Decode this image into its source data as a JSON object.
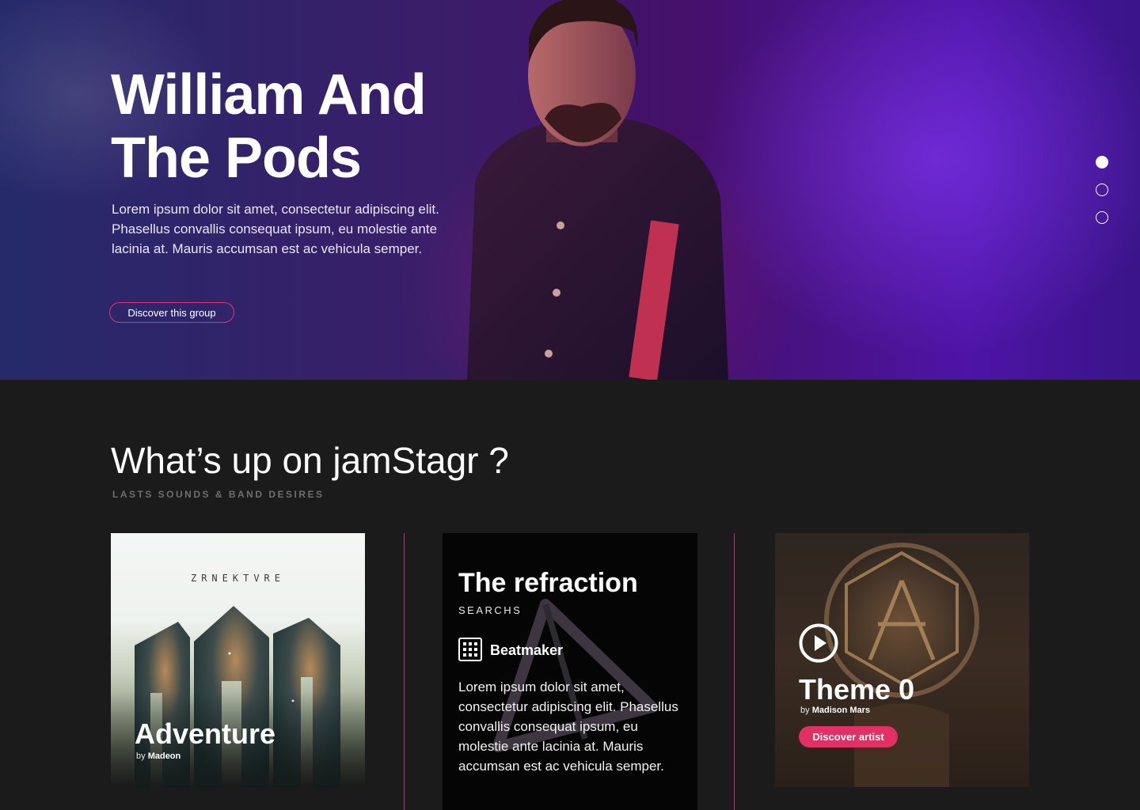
{
  "hero": {
    "title_line1": "William And",
    "title_line2": "The Pods",
    "description": "Lorem ipsum dolor sit amet, consectetur adipiscing elit. Phasellus convallis consequat ipsum, eu molestie ante lacinia at. Mauris accumsan est ac vehicula semper.",
    "button_label": "Discover this group",
    "slides": {
      "total": 3,
      "active": 1
    },
    "accent_color": "#e0327a"
  },
  "section": {
    "title": "What’s up on jamStagr ?",
    "subtitle": "LASTS SOUNDS & BAND DESIRES"
  },
  "cards": [
    {
      "album_logo": "ZRNEKTVRE",
      "title": "Adventure",
      "by": "by",
      "artist": "Madeon"
    },
    {
      "title": "The refraction",
      "subtitle": "SEARCHS",
      "badge_icon": "grid-icon",
      "badge": "Beatmaker",
      "description": "Lorem ipsum dolor sit amet, consectetur adipiscing elit. Phasellus convallis consequat ipsum, eu molestie ante lacinia at. Mauris accumsan est ac vehicula semper."
    },
    {
      "play_icon": "play-circle-icon",
      "title": "Theme 0",
      "by": "by",
      "artist": "Madison Mars",
      "button_label": "Discover artist",
      "button_color": "#e03064"
    }
  ]
}
